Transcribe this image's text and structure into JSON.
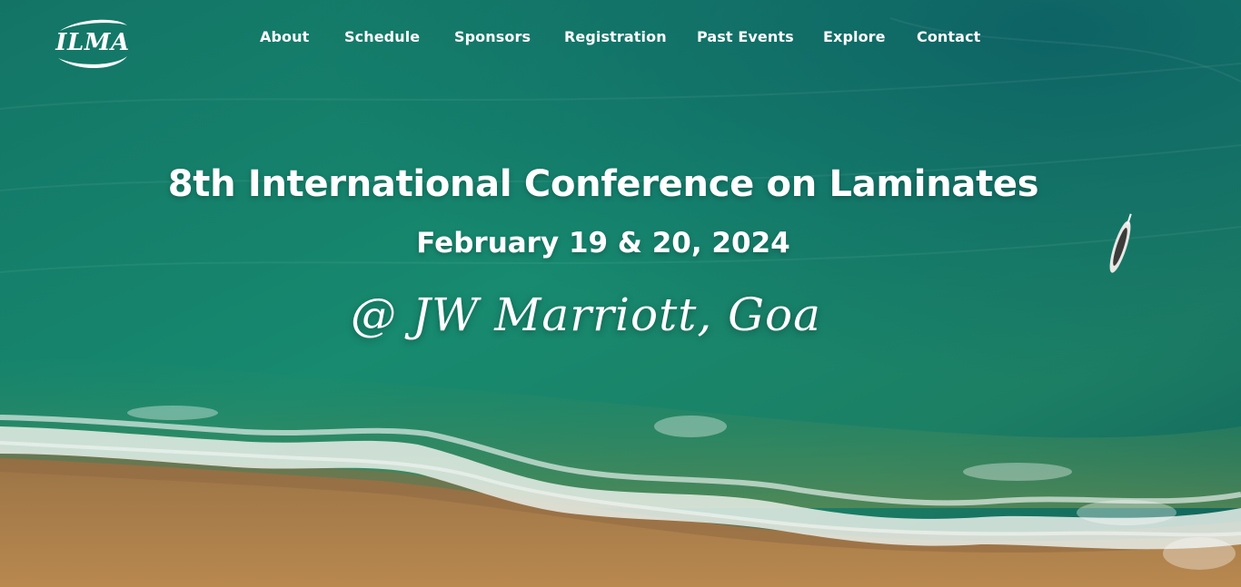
{
  "brand": {
    "logo_text": "ILMA"
  },
  "nav": {
    "items": [
      {
        "label": "About"
      },
      {
        "label": "Schedule"
      },
      {
        "label": "Sponsors"
      },
      {
        "label": "Registration"
      },
      {
        "label": "Past Events"
      },
      {
        "label": "Explore"
      },
      {
        "label": "Contact"
      }
    ]
  },
  "hero": {
    "title": "8th International Conference on Laminates",
    "date": "February 19 & 20, 2024",
    "venue": "@ JW Marriott, Goa"
  },
  "colors": {
    "ocean_deep": "#0d6b62",
    "ocean_light": "#1f8a73",
    "sand": "#b48552",
    "foam": "#e9efe9",
    "text": "#ffffff"
  }
}
